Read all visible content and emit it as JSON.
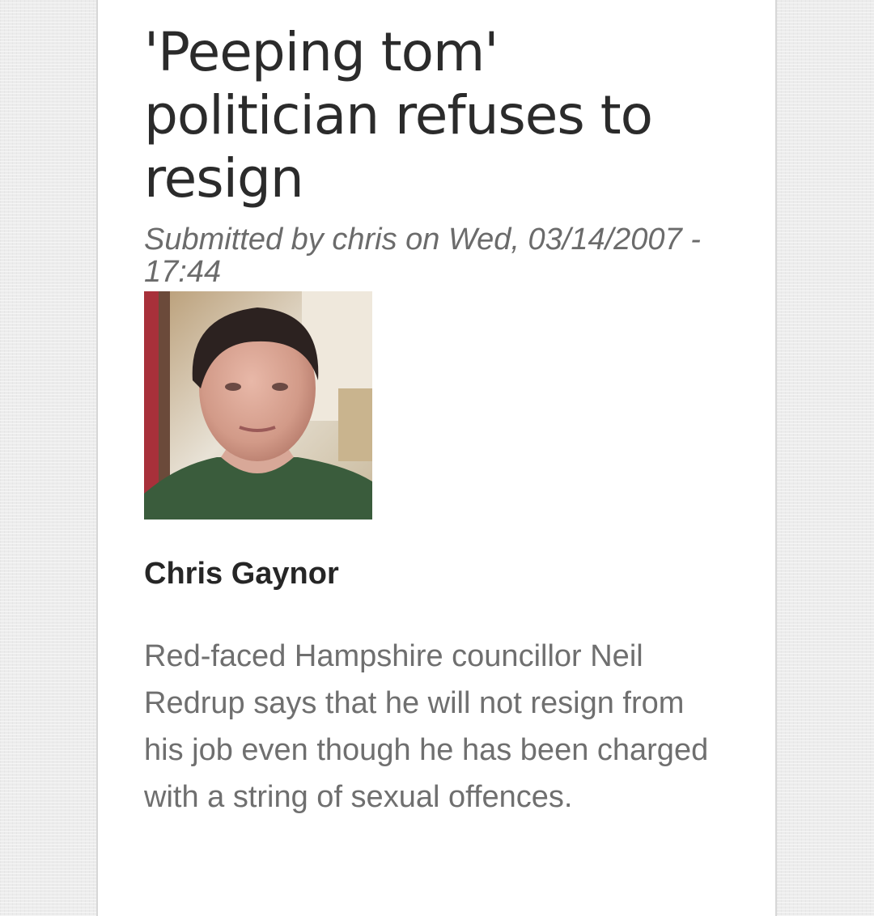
{
  "article": {
    "title": "'Peeping tom' politician refuses to resign",
    "submitted": "Submitted by chris on Wed, 03/14/2007 - 17:44",
    "author_name": "Chris Gaynor",
    "body": "Red-faced Hampshire councillor Neil Redrup says that he will not resign from his job even though he has been charged with a string of sexual offences."
  },
  "colors": {
    "page_background": "#ececec",
    "content_background": "#ffffff",
    "title_text": "#2b2b2b",
    "meta_text": "#6b6b6b",
    "body_text": "#6f6f6f"
  }
}
